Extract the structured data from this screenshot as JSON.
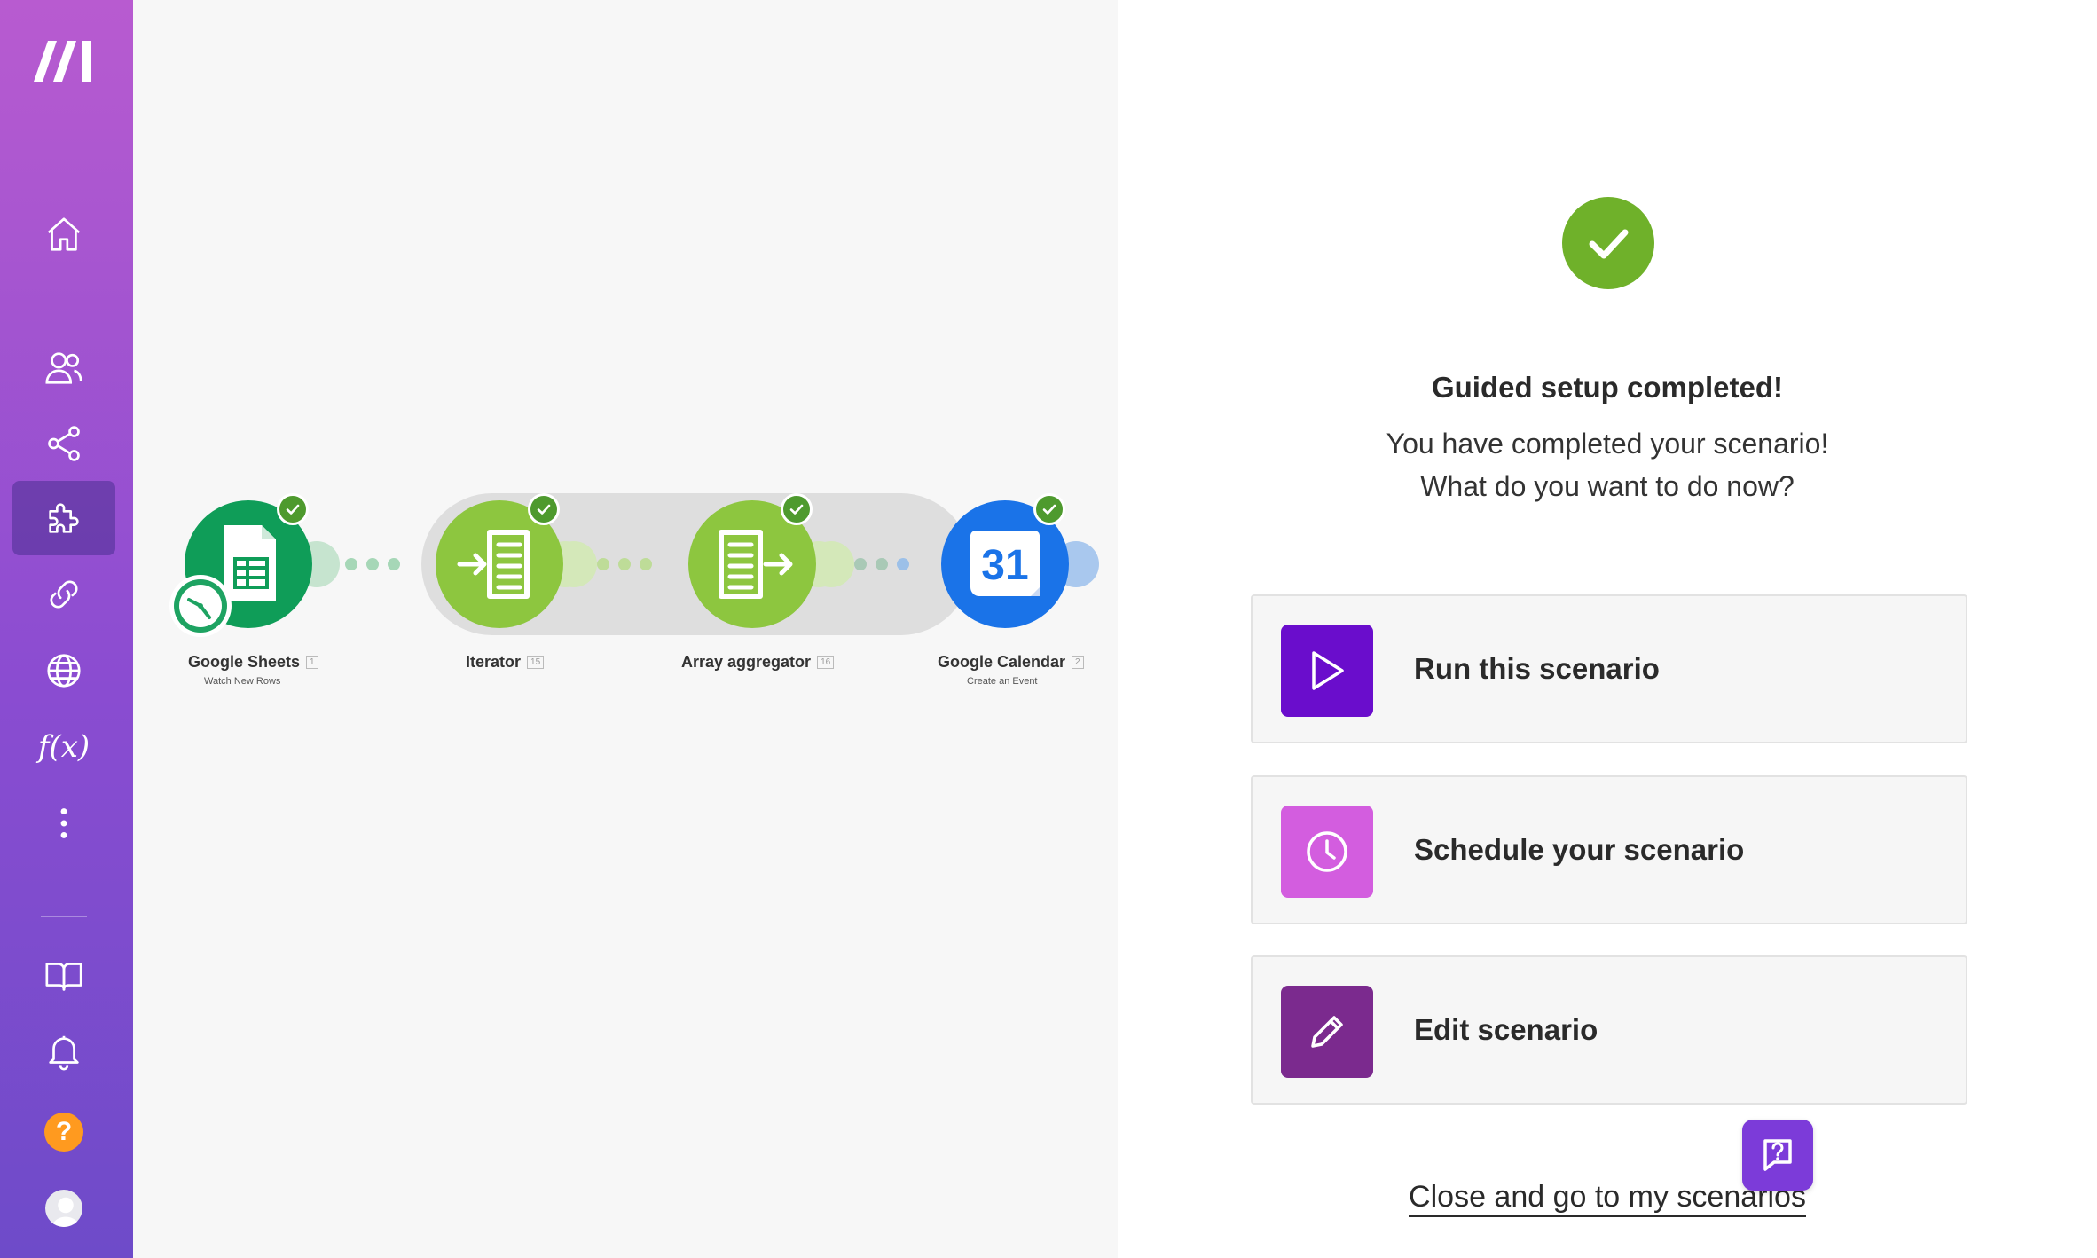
{
  "sidebar": {
    "items": [
      {
        "name": "home",
        "icon": "home-icon"
      },
      {
        "name": "team",
        "icon": "users-icon"
      },
      {
        "name": "scenarios",
        "icon": "share-icon"
      },
      {
        "name": "apps",
        "icon": "puzzle-icon",
        "active": true
      },
      {
        "name": "connections",
        "icon": "link-icon"
      },
      {
        "name": "webhooks",
        "icon": "globe-icon"
      },
      {
        "name": "functions",
        "icon": "function-icon",
        "label": "f(x)"
      },
      {
        "name": "more",
        "icon": "more-vertical-icon"
      },
      {
        "name": "docs",
        "icon": "book-icon"
      },
      {
        "name": "notifications",
        "icon": "bell-icon"
      },
      {
        "name": "help",
        "icon": "help-icon",
        "label": "?"
      },
      {
        "name": "profile",
        "icon": "avatar-icon"
      }
    ]
  },
  "canvas": {
    "modules": [
      {
        "name": "Google Sheets",
        "id": "1",
        "subtitle": "Watch New Rows",
        "color": "#0f9d58"
      },
      {
        "name": "Iterator",
        "id": "15",
        "subtitle": "",
        "color": "#8dc63f"
      },
      {
        "name": "Array aggregator",
        "id": "16",
        "subtitle": "",
        "color": "#8dc63f"
      },
      {
        "name": "Google Calendar",
        "id": "2",
        "subtitle": "Create an Event",
        "color": "#1a73e8",
        "day": "31"
      }
    ]
  },
  "panel": {
    "title": "Guided setup completed!",
    "description_line1": "You have completed your scenario!",
    "description_line2": "What do you want to do now?",
    "actions": [
      {
        "label": "Run this scenario",
        "icon": "play-icon",
        "color": "#6a0dcc"
      },
      {
        "label": "Schedule your scenario",
        "icon": "clock-icon",
        "color": "#d35ddf"
      },
      {
        "label": "Edit scenario",
        "icon": "pencil-icon",
        "color": "#7b2a8e"
      }
    ],
    "close_label": "Close and go to my scenarios"
  },
  "colors": {
    "success": "#6fb12a",
    "check_badge": "#4e9a2e",
    "chat_button": "#7c3bd9"
  }
}
